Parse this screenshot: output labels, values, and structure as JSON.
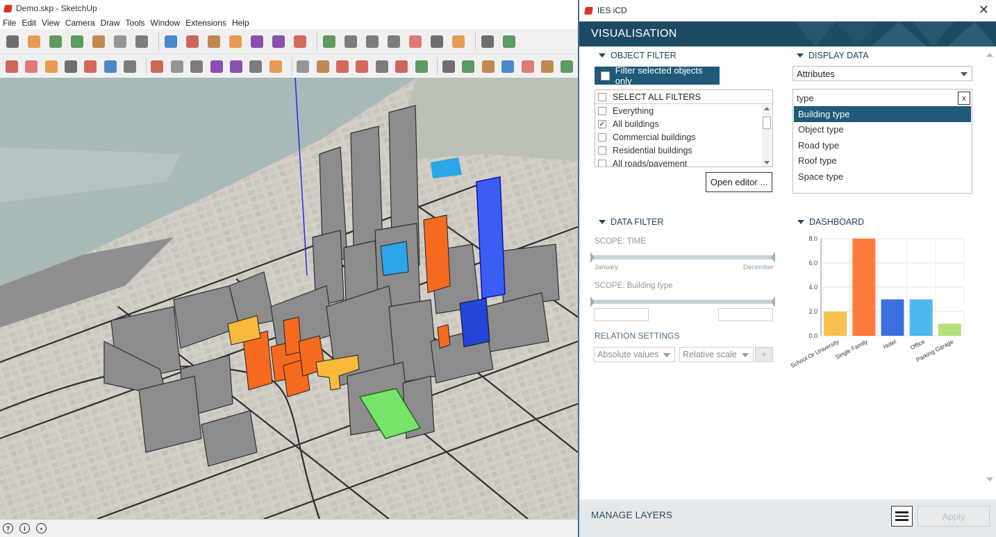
{
  "sketchup": {
    "title": "Demo.skp - SketchUp",
    "menu": [
      "File",
      "Edit",
      "View",
      "Camera",
      "Draw",
      "Tools",
      "Window",
      "Extensions",
      "Help"
    ],
    "toolbar1_icons": [
      "select-icon",
      "eraser-icon",
      "pencil-icon",
      "arc-icon",
      "rectangle-icon",
      "push-pull-icon",
      "follow-me-icon",
      "move-icon",
      "rotate-icon",
      "scale-icon",
      "tape-measure-icon",
      "text-icon",
      "paint-bucket-icon",
      "orbit-icon",
      "pan-icon",
      "zoom-icon",
      "zoom-extents-icon",
      "warehouse-icon",
      "extension-warehouse-icon",
      "send-icon",
      "ruby-icon",
      "move-axes-icon",
      "add-location-icon"
    ],
    "toolbar2_icons": [
      "iso-view-icon",
      "line-icon",
      "rectangle-tool-icon",
      "top-view-icon",
      "front-view-icon",
      "right-view-icon",
      "back-view-icon",
      "left-view-icon",
      "bottom-view-icon",
      "camera-view-icon",
      "section-icon",
      "display-section-icon",
      "ve-icon",
      "ve2-icon",
      "xray-icon",
      "up-arrows-icon",
      "terrain-icon",
      "door-icon",
      "import-icon",
      "export-icon",
      "warning-icon",
      "green-box-icon",
      "green-sphere-icon",
      "red-box-icon",
      "grey-box-icon",
      "white-box-icon",
      "lightning-icon",
      "settings-icon"
    ],
    "status_icons": [
      "geo-location-icon",
      "credit-icon",
      "account-icon"
    ]
  },
  "ies": {
    "title": "IES iCD",
    "header": "VISUALISATION",
    "object_filter": {
      "heading": "OBJECT FILTER",
      "filter_selected_label": "Filter selected objects only",
      "select_all_label": "SELECT ALL FILTERS",
      "items": [
        {
          "label": "Everything",
          "checked": false
        },
        {
          "label": "All buildings",
          "checked": true
        },
        {
          "label": "Commercial buildings",
          "checked": false
        },
        {
          "label": "Residential buildings",
          "checked": false
        },
        {
          "label": "All roads/pavement",
          "checked": false
        }
      ],
      "open_editor_label": "Open editor ..."
    },
    "display_data": {
      "heading": "DISPLAY DATA",
      "selected": "Attributes",
      "search_value": "type",
      "clear_label": "x",
      "items": [
        "Building type",
        "Object type",
        "Road type",
        "Roof type",
        "Space type"
      ],
      "selected_item": "Building type"
    },
    "data_filter": {
      "heading": "DATA FILTER",
      "scope_time_label": "SCOPE: TIME",
      "time_start": "January",
      "time_end": "December",
      "scope_building_label": "SCOPE: Building type",
      "relation_label": "RELATION SETTINGS",
      "relation_mode": "Absolute values",
      "relation_scale": "Relative scale",
      "plus_label": "+"
    },
    "dashboard": {
      "heading": "DASHBOARD"
    },
    "footer": {
      "manage_layers": "MANAGE LAYERS",
      "apply_label": "Apply"
    },
    "colors": {
      "header": "#1f4a63",
      "accent": "#1f5a78"
    }
  },
  "chart_data": {
    "type": "bar",
    "categories": [
      "School Or University",
      "Single Family",
      "Hotel",
      "Office",
      "Parking Garage"
    ],
    "values": [
      2.0,
      8.0,
      3.0,
      3.0,
      1.0
    ],
    "colors": [
      "#f8c14e",
      "#ff7a3c",
      "#3b6fe0",
      "#4cb8ef",
      "#b5e07a"
    ],
    "yticks": [
      "0.0",
      "2.0",
      "4.0",
      "6.0",
      "8.0"
    ],
    "ylim": [
      0,
      8
    ],
    "grid": true,
    "legend": "none"
  }
}
